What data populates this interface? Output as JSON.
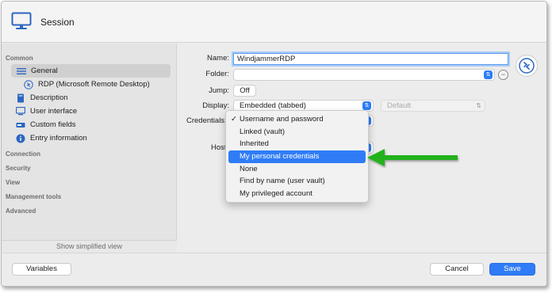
{
  "window": {
    "title": "Session"
  },
  "sidebar": {
    "sections": {
      "common": "Common",
      "connection": "Connection",
      "security": "Security",
      "view": "View",
      "management_tools": "Management tools",
      "advanced": "Advanced"
    },
    "items": [
      {
        "label": "General",
        "icon": "list-icon",
        "selected": true
      },
      {
        "label": "RDP (Microsoft Remote Desktop)",
        "icon": "rdp-icon"
      },
      {
        "label": "Description",
        "icon": "book-icon"
      },
      {
        "label": "User interface",
        "icon": "monitor-icon"
      },
      {
        "label": "Custom fields",
        "icon": "fields-icon"
      },
      {
        "label": "Entry information",
        "icon": "info-icon"
      }
    ],
    "show_simplified": "Show simplified view"
  },
  "form": {
    "name_label": "Name:",
    "name_value": "WindjammerRDP",
    "folder_label": "Folder:",
    "folder_value": "",
    "jump_label": "Jump:",
    "jump_value": "Off",
    "display_label": "Display:",
    "display_value": "Embedded (tabbed)",
    "display_secondary": "Default",
    "credentials_label": "Credentials:",
    "host_label": "Host:"
  },
  "credentials_menu": {
    "options": [
      "Username and password",
      "Linked (vault)",
      "Inherited",
      "My personal credentials",
      "None",
      "Find by name (user vault)",
      "My privileged account"
    ],
    "checked_index": 0,
    "highlighted_index": 3,
    "checkmark": "✓"
  },
  "footer": {
    "variables": "Variables",
    "cancel": "Cancel",
    "save": "Save"
  },
  "colors": {
    "accent": "#2f7cf6",
    "arrow": "#22b21f"
  }
}
